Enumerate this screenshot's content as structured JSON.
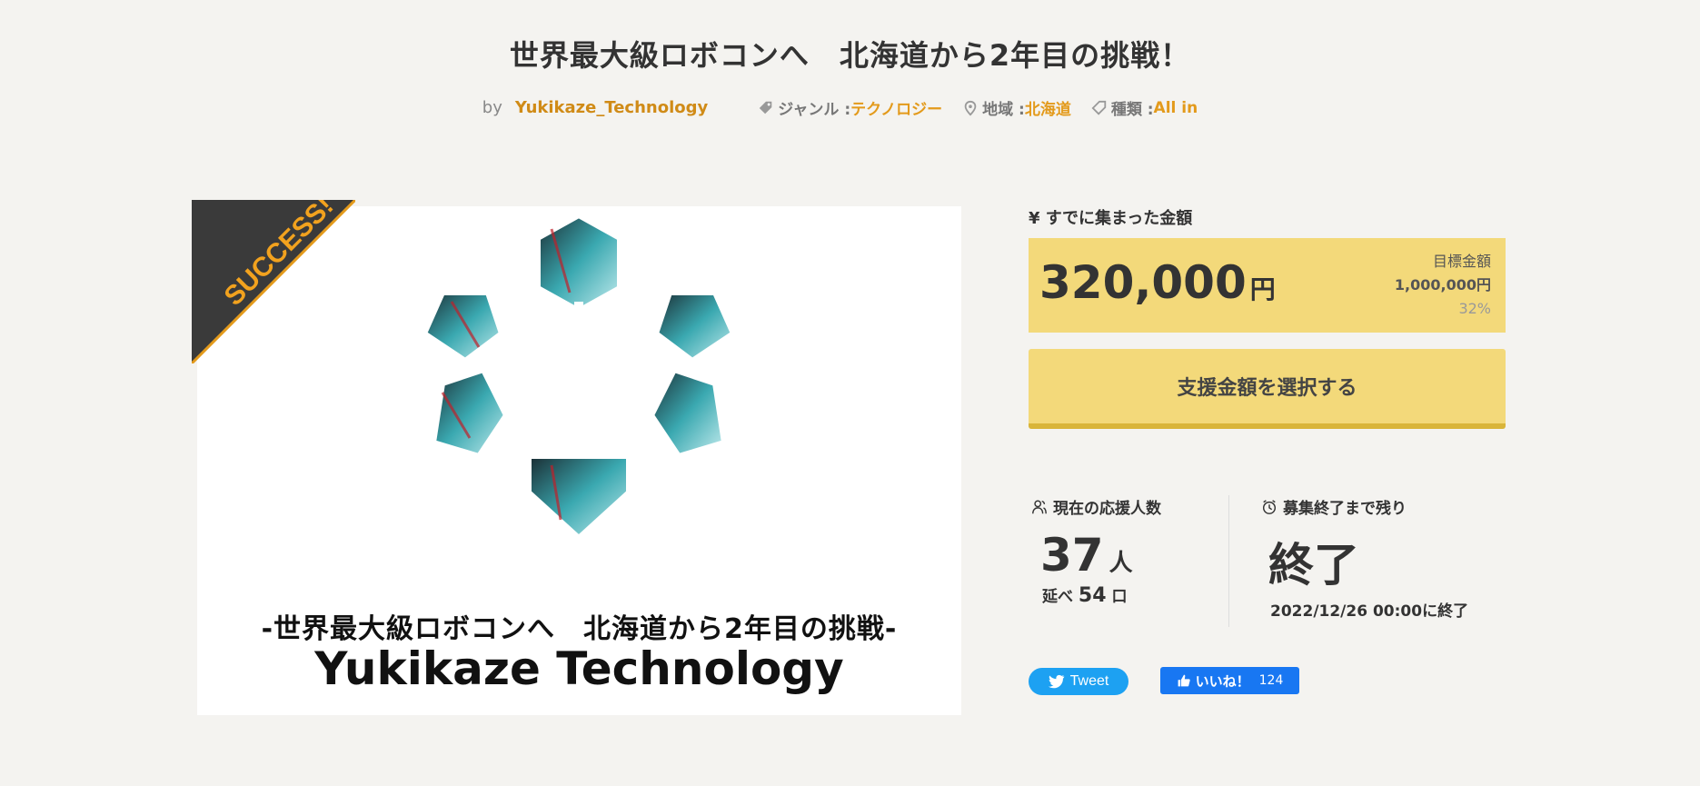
{
  "title": "世界最大級ロボコンへ　北海道から2年目の挑戦！",
  "meta": {
    "by_label": "by",
    "author": "Yukikaze_Technology",
    "genre_label": "ジャンル :",
    "genre": "テクノロジー",
    "region_label": "地域 :",
    "region": "北海道",
    "type_label": "種類 :",
    "type": "All in"
  },
  "hero": {
    "badge": "SUCCESS!",
    "caption_line1": "-世界最大級ロボコンへ　北海道から2年目の挑戦-",
    "caption_line2": "Yukikaze Technology"
  },
  "funding": {
    "raised_label": "¥ すでに集まった金額",
    "amount": "320,000",
    "currency": "円",
    "goal_label": "目標金額",
    "goal": "1,000,000円",
    "percent": "32%",
    "support_button": "支援金額を選択する"
  },
  "stats": {
    "backers_label": "現在の応援人数",
    "backers": "37",
    "backers_unit": "人",
    "total_label": "延べ",
    "total": "54",
    "total_unit": "口",
    "remaining_label": "募集終了まで残り",
    "remaining": "終了",
    "end_date": "2022/12/26 00:00に終了"
  },
  "social": {
    "tweet": "Tweet",
    "like": "いいね！",
    "like_count": "124"
  },
  "colors": {
    "accent": "#e39a1b",
    "author": "#d08b17",
    "panel": "#f3d97a",
    "twitter": "#1da1f2",
    "facebook": "#1877f2"
  }
}
